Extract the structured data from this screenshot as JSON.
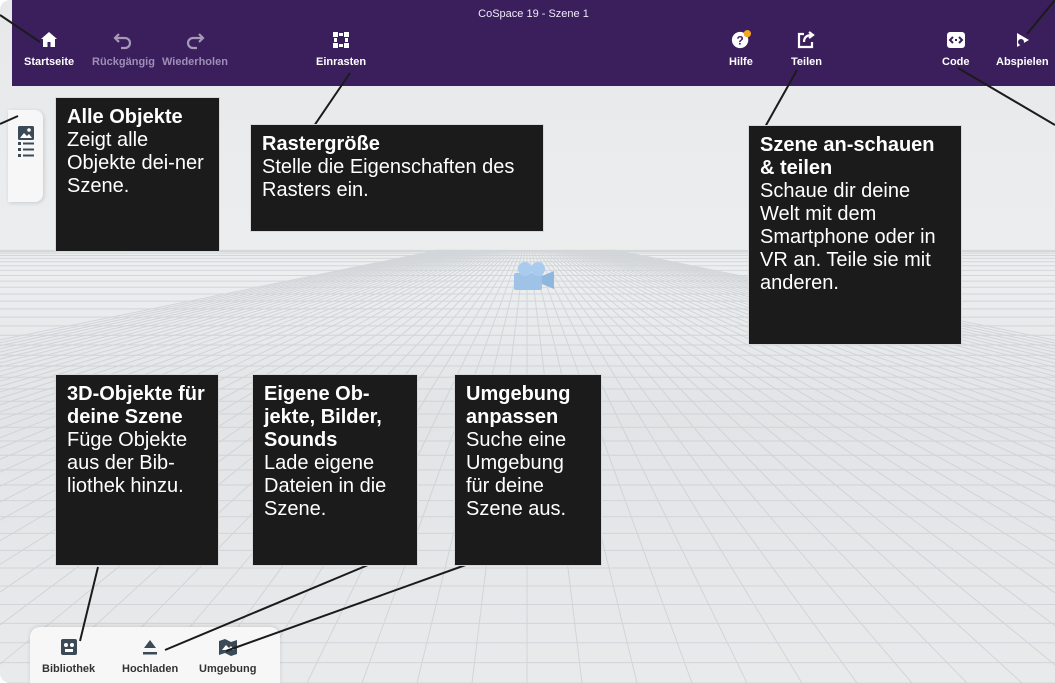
{
  "app": {
    "title": "CoSpace 19 - Szene 1"
  },
  "toolbar": {
    "home": {
      "label": "Startseite",
      "icon": "home-icon"
    },
    "undo": {
      "label": "Rückgängig",
      "icon": "undo-icon"
    },
    "redo": {
      "label": "Wiederholen",
      "icon": "redo-icon"
    },
    "snap": {
      "label": "Einrasten",
      "icon": "grid-snap-icon"
    },
    "help": {
      "label": "Hilfe",
      "icon": "help-icon"
    },
    "share": {
      "label": "Teilen",
      "icon": "share-icon"
    },
    "code": {
      "label": "Code",
      "icon": "code-icon"
    },
    "play": {
      "label": "Abspielen",
      "icon": "play-icon"
    }
  },
  "left_tab": {
    "icons": [
      "image-icon",
      "list-icon"
    ]
  },
  "bottom_tab": {
    "library": {
      "label": "Bibliothek",
      "icon": "library-icon"
    },
    "upload": {
      "label": "Hochladen",
      "icon": "upload-icon"
    },
    "environment": {
      "label": "Umgebung",
      "icon": "environment-icon"
    }
  },
  "callouts": {
    "all_objects": {
      "title": "Alle Objekte",
      "body": "Zeigt alle Objekte dei-ner Szene."
    },
    "grid_size": {
      "title": "Rastergröße",
      "body": "Stelle die Eigenschaften des Rasters ein."
    },
    "view_share": {
      "title": "Szene an-schauen & teilen",
      "body": "Schaue dir deine Welt mit dem Smartphone oder in VR an. Teile sie mit anderen."
    },
    "objects_3d": {
      "title": "3D-Objekte für deine Szene",
      "body": "Füge Objekte aus der Bib-liothek hinzu."
    },
    "own_objects": {
      "title": "Eigene Ob-jekte, Bilder, Sounds",
      "body": "Lade eigene Dateien in die Szene."
    },
    "environment": {
      "title": "Umgebung anpassen",
      "body": "Suche eine Umgebung für deine Szene aus."
    }
  },
  "colors": {
    "topbar": "#3a1f5c",
    "callout_bg": "#1b1b1b",
    "help_badge": "#f5a623"
  }
}
